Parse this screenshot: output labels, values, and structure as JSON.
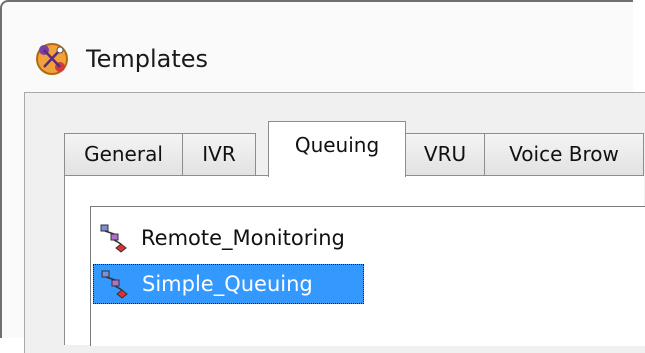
{
  "window": {
    "title": "Templates",
    "title_icon": "templates-app-icon"
  },
  "tabs": [
    {
      "label": "General",
      "active": false
    },
    {
      "label": "IVR",
      "active": false
    },
    {
      "label": "Queuing",
      "active": true
    },
    {
      "label": "VRU",
      "active": false
    },
    {
      "label": "Voice Brow",
      "active": false
    }
  ],
  "templates_list": {
    "items": [
      {
        "label": "Remote_Monitoring",
        "icon": "script-flow-icon",
        "selected": false
      },
      {
        "label": "Simple_Queuing",
        "icon": "script-flow-icon",
        "selected": true
      }
    ]
  },
  "colors": {
    "selection": "#3399ff",
    "window_border": "#6f6f6f"
  }
}
